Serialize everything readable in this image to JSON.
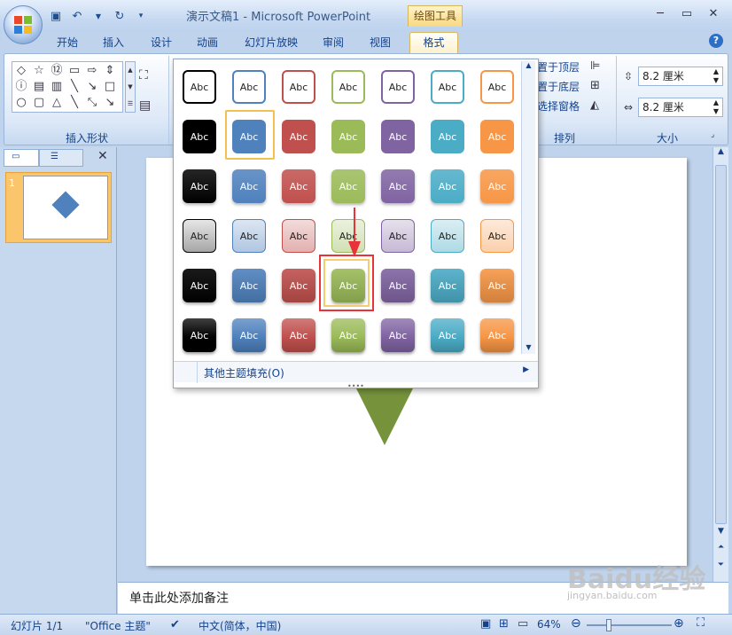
{
  "window": {
    "title": "演示文稿1 - Microsoft PowerPoint",
    "context_tab": "绘图工具",
    "controls": {
      "minimize": "─",
      "restore": "▭",
      "close": "✕"
    }
  },
  "tabs": [
    "开始",
    "插入",
    "设计",
    "动画",
    "幻灯片放映",
    "审阅",
    "视图"
  ],
  "active_tab": "格式",
  "help": "?",
  "ribbon": {
    "insert_shapes_label": "插入形状",
    "arrange_label": "排列",
    "size_label": "大小",
    "arrange_items": [
      "置于顶层",
      "置于底层",
      "选择窗格"
    ],
    "height_value": "8.2 厘米",
    "width_value": "8.2 厘米"
  },
  "gallery": {
    "more_fills": "其他主题填充(O)",
    "swatch_text": "Abc",
    "colors": [
      "#000000",
      "#4f81bd",
      "#c0504d",
      "#9bbb59",
      "#8064a2",
      "#4bacc6",
      "#f79646"
    ],
    "rows": [
      "outline",
      "solid",
      "subtle",
      "light",
      "intense",
      "strong"
    ],
    "selected": {
      "row": 1,
      "col": 1
    },
    "highlighted": {
      "row": 4,
      "col": 3
    }
  },
  "slides_pane": {
    "slide_number": "1"
  },
  "notes": {
    "placeholder": "单击此处添加备注"
  },
  "status": {
    "slide": "幻灯片 1/1",
    "theme": "\"Office 主题\"",
    "language": "中文(简体，中国)",
    "zoom": "64%"
  },
  "watermark": {
    "text": "Baidu经验",
    "sub": "jingyan.baidu.com"
  }
}
